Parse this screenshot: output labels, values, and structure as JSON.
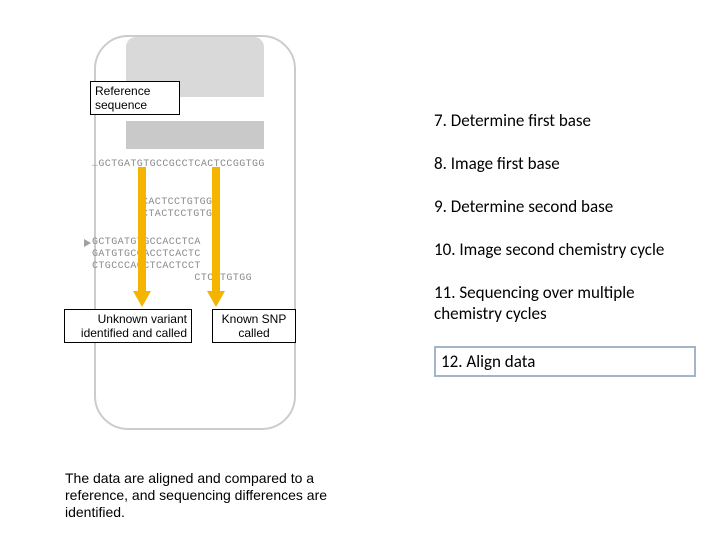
{
  "labels": {
    "reference_sequence": "Reference sequence",
    "unknown_variant": "Unknown variant identified and called",
    "known_snp": "Known SNP called"
  },
  "sequences": {
    "ref_line": "…GCTGATGTGCCGCCTCACTCCGGTGG",
    "stack": "CACTCCTGTGG\nCTACTCCTGTGG",
    "stack2": "GCTGATGTGCCACCTCA\nGATGTGCCACCTCACTC\nCTGCCCACCTCACTCCT\n                CTCCTGTGG"
  },
  "caption": "The data are aligned and compared to a reference, and sequencing differences are identified.",
  "steps": [
    {
      "n": "7",
      "text": "Determine first base"
    },
    {
      "n": "8",
      "text": "Image first base"
    },
    {
      "n": "9",
      "text": "Determine second base"
    },
    {
      "n": "10",
      "text": "Image second chemistry cycle"
    },
    {
      "n": "11",
      "text": "Sequencing over multiple chemistry cycles"
    },
    {
      "n": "12",
      "text": "Align data",
      "highlight": true
    }
  ]
}
